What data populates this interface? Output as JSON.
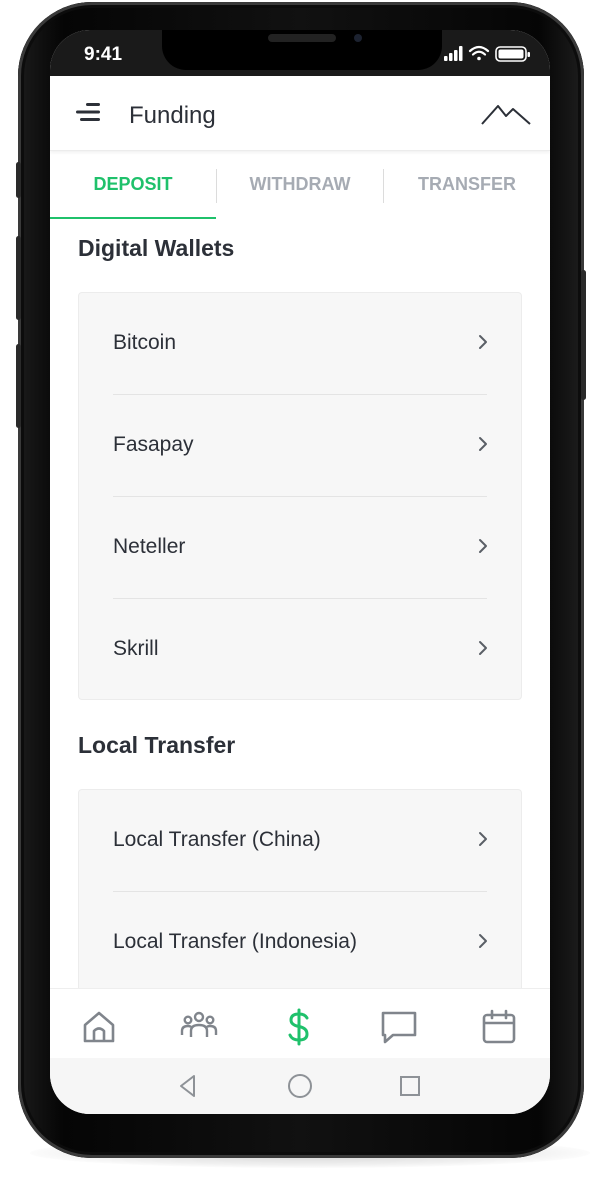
{
  "status_bar": {
    "time": "9:41"
  },
  "header": {
    "title": "Funding",
    "menu_icon": "menu-icon",
    "logo_icon": "mountain-logo-icon"
  },
  "tabs": [
    {
      "label": "DEPOSIT",
      "active": true
    },
    {
      "label": "WITHDRAW",
      "active": false
    },
    {
      "label": "TRANSFER",
      "active": false
    }
  ],
  "sections": [
    {
      "title": "Digital Wallets",
      "items": [
        {
          "label": "Bitcoin"
        },
        {
          "label": "Fasapay"
        },
        {
          "label": "Neteller"
        },
        {
          "label": "Skrill"
        }
      ]
    },
    {
      "title": "Local Transfer",
      "items": [
        {
          "label": "Local Transfer (China)"
        },
        {
          "label": "Local Transfer (Indonesia)"
        }
      ]
    }
  ],
  "bottom_nav": [
    {
      "icon": "home-icon",
      "active": false
    },
    {
      "icon": "users-icon",
      "active": false
    },
    {
      "icon": "dollar-icon",
      "active": true
    },
    {
      "icon": "chat-icon",
      "active": false
    },
    {
      "icon": "calendar-icon",
      "active": false
    }
  ],
  "system_nav": [
    "back-icon",
    "home-circle-icon",
    "recents-icon"
  ],
  "colors": {
    "accent": "#1fc16b",
    "text": "#2c3038",
    "muted": "#a6abb3",
    "card_bg": "#f7f7f7"
  }
}
